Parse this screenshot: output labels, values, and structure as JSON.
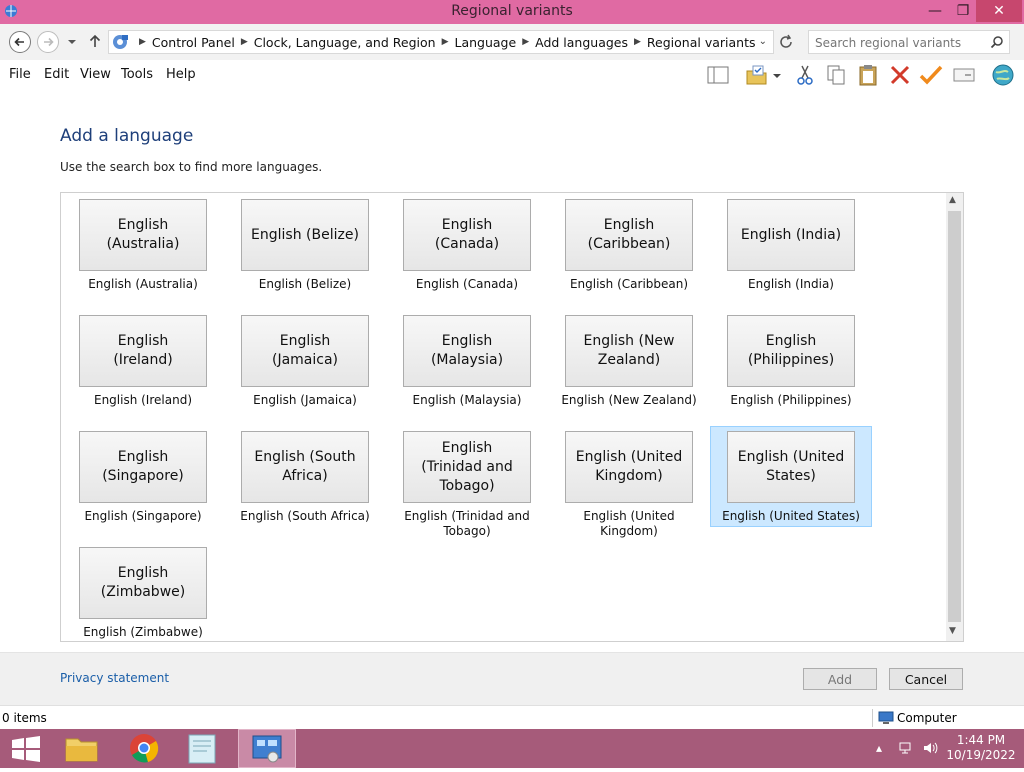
{
  "window": {
    "title": "Regional variants"
  },
  "address": {
    "crumbs": [
      "Control Panel",
      "Clock, Language, and Region",
      "Language",
      "Add languages",
      "Regional variants"
    ]
  },
  "search": {
    "placeholder": "Search regional variants"
  },
  "menu": [
    "File",
    "Edit",
    "View",
    "Tools",
    "Help"
  ],
  "toolbar_icons": [
    "layout-pane-icon",
    "folder-check-icon",
    "cut-icon",
    "copy-icon",
    "paste-icon",
    "delete-icon",
    "check-icon",
    "properties-icon",
    "globe-icon"
  ],
  "main": {
    "heading": "Add a language",
    "subtext": "Use the search box to find more languages."
  },
  "languages": [
    {
      "button": "English (Australia)",
      "caption": "English (Australia)"
    },
    {
      "button": "English (Belize)",
      "caption": "English (Belize)"
    },
    {
      "button": "English (Canada)",
      "caption": "English (Canada)"
    },
    {
      "button": "English (Caribbean)",
      "caption": "English (Caribbean)"
    },
    {
      "button": "English (India)",
      "caption": "English (India)"
    },
    {
      "button": "English (Ireland)",
      "caption": "English (Ireland)"
    },
    {
      "button": "English (Jamaica)",
      "caption": "English (Jamaica)"
    },
    {
      "button": "English (Malaysia)",
      "caption": "English (Malaysia)"
    },
    {
      "button": "English (New Zealand)",
      "caption": "English (New Zealand)"
    },
    {
      "button": "English (Philippines)",
      "caption": "English (Philippines)"
    },
    {
      "button": "English (Singapore)",
      "caption": "English (Singapore)"
    },
    {
      "button": "English (South Africa)",
      "caption": "English (South Africa)"
    },
    {
      "button": "English (Trinidad and Tobago)",
      "caption": "English (Trinidad and Tobago)"
    },
    {
      "button": "English (United Kingdom)",
      "caption": "English (United Kingdom)"
    },
    {
      "button": "English (United States)",
      "caption": "English (United States)",
      "selected": true
    },
    {
      "button": "English (Zimbabwe)",
      "caption": "English (Zimbabwe)"
    }
  ],
  "footer": {
    "privacy": "Privacy statement",
    "add": "Add",
    "cancel": "Cancel"
  },
  "status": {
    "items": "0 items",
    "location": "Computer"
  },
  "taskbar": {
    "apps": [
      "start-icon",
      "file-explorer-icon",
      "chrome-icon",
      "notepad-icon",
      "control-panel-icon"
    ],
    "time": "1:44 PM",
    "date": "10/19/2022"
  },
  "colors": {
    "titlebar": "#e06aa3",
    "taskbar": "#a65b7a",
    "selection": "#cce8ff",
    "link": "#1a5ea8",
    "heading": "#1e3f7a"
  }
}
